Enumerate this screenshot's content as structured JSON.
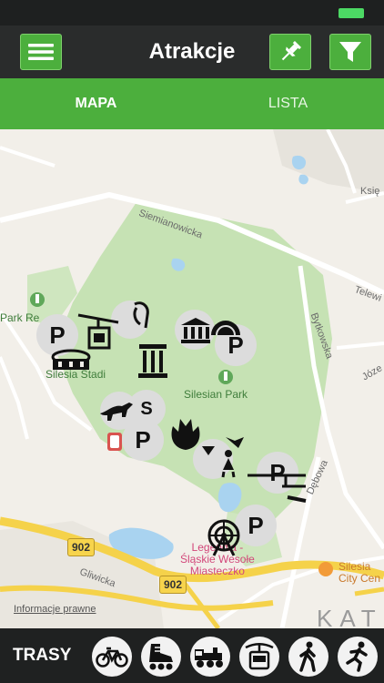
{
  "header": {
    "title": "Atrakcje",
    "icons": {
      "menu": "hamburger-menu-icon",
      "pin": "pushpin-icon",
      "filter": "funnel-filter-icon"
    },
    "accent_color": "#4caf3d"
  },
  "tabs": [
    {
      "label": "MAPA",
      "active": true
    },
    {
      "label": "LISTA",
      "active": false
    }
  ],
  "map": {
    "park_name": "Silesian Park",
    "park_left_label": "Park Re",
    "stadium_label": "Silesia Stadi",
    "amusement_park_label_line1": "Legendia -",
    "amusement_park_label_line2": "Śląskie Wesołe",
    "amusement_park_label_line3": "Miasteczko",
    "mall_label_line1": "Silesia",
    "mall_label_line2": "City Cen",
    "roads": {
      "siemianowicka": "Siemianowicka",
      "bytkowska": "Bytkowska",
      "telewizyjna": "Telewi",
      "ksieza": "Księ",
      "jozefa": "Józe",
      "debowa": "Dębowa",
      "gliwicka": "Gliwicka"
    },
    "route_number_1": "902",
    "route_number_2": "902",
    "legal_link": "Informacje prawne",
    "city_watermark": "KAT",
    "markers": {
      "parking_1": "P",
      "parking_2": "P",
      "parking_3": "P",
      "parking_4": "P",
      "parking_5": "P",
      "sightseeing": "S"
    }
  },
  "bottom_bar": {
    "label": "TRASY",
    "routes": [
      {
        "name": "bicycle-icon"
      },
      {
        "name": "inline-skate-icon"
      },
      {
        "name": "train-icon"
      },
      {
        "name": "cable-car-icon"
      },
      {
        "name": "walking-icon"
      },
      {
        "name": "running-icon"
      }
    ]
  }
}
